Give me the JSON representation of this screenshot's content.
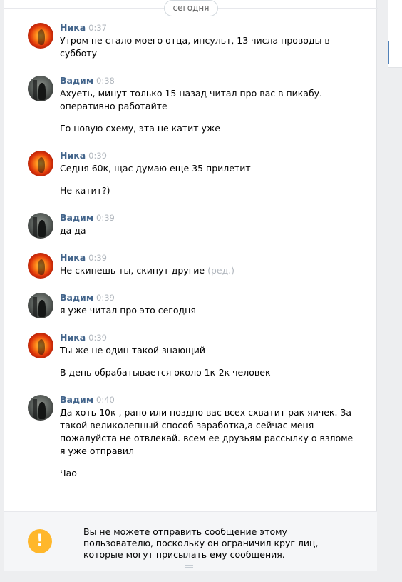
{
  "date_divider": "сегодня",
  "messages": [
    {
      "author": "Ника",
      "time": "0:37",
      "lines": [
        "Утром не стало моего отца, инсульт, 13 числа проводы в",
        "субботу"
      ]
    },
    {
      "author": "Вадим",
      "time": "0:38",
      "lines": [
        "Ахуеть, минут только 15 назад читал про вас в пикабу.",
        "оперативно работайте"
      ],
      "extra": [
        "Го новую схему, эта не катит уже"
      ]
    },
    {
      "author": "Ника",
      "time": "0:39",
      "lines": [
        "Седня 60к, щас думаю еще 35 прилетит"
      ],
      "extra": [
        "Не катит?)"
      ]
    },
    {
      "author": "Вадим",
      "time": "0:39",
      "lines": [
        "да да"
      ]
    },
    {
      "author": "Ника",
      "time": "0:39",
      "lines": [
        "Не скинешь ты, скинут другие"
      ],
      "edited": "(ред.)"
    },
    {
      "author": "Вадим",
      "time": "0:39",
      "lines": [
        "я уже читал про это сегодня"
      ]
    },
    {
      "author": "Ника",
      "time": "0:39",
      "lines": [
        "Ты же не один такой знающий"
      ],
      "extra": [
        "В день обрабатывается около 1к-2к человек"
      ]
    },
    {
      "author": "Вадим",
      "time": "0:40",
      "lines": [
        "Да хоть 10к , рано или поздно вас всех схватит рак яичек. За",
        "такой великолепный способ заработка,а сейчас меня",
        "пожалуйста не отвлекай. всем ее друзьям рассылку о взломе",
        "я уже отправил"
      ],
      "extra": [
        "Чао"
      ]
    }
  ],
  "notice": {
    "icon": "exclamation-icon",
    "text": "Вы не можете отправить сообщение этому пользователю, поскольку он ограничил круг лиц, которые могут присылать ему сообщения."
  },
  "colors": {
    "name": "#42648b",
    "time": "#b0b6bd",
    "warning": "#ffb72b",
    "accent": "#5181b8"
  }
}
